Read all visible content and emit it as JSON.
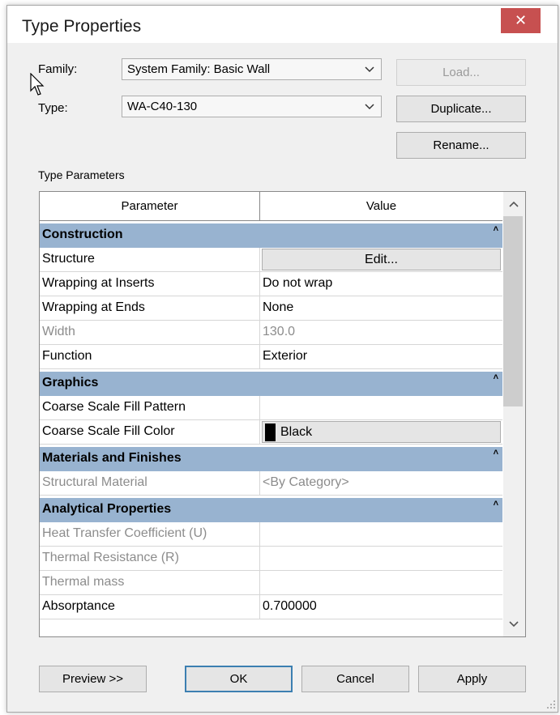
{
  "window": {
    "title": "Type Properties"
  },
  "family": {
    "label": "Family:",
    "value": "System Family: Basic Wall"
  },
  "type": {
    "label": "Type:",
    "value": "WA-C40-130"
  },
  "buttons": {
    "load": "Load...",
    "duplicate": "Duplicate...",
    "rename": "Rename...",
    "preview": "Preview >>",
    "ok": "OK",
    "cancel": "Cancel",
    "apply": "Apply"
  },
  "section_label": "Type Parameters",
  "grid": {
    "header_parameter": "Parameter",
    "header_value": "Value",
    "groups": {
      "construction": "Construction",
      "graphics": "Graphics",
      "materials": "Materials and Finishes",
      "analytical": "Analytical Properties"
    },
    "rows": {
      "structure": {
        "name": "Structure",
        "value": "Edit..."
      },
      "wrap_inserts": {
        "name": "Wrapping at Inserts",
        "value": "Do not wrap"
      },
      "wrap_ends": {
        "name": "Wrapping at Ends",
        "value": "None"
      },
      "width": {
        "name": "Width",
        "value": "130.0"
      },
      "function": {
        "name": "Function",
        "value": "Exterior"
      },
      "fill_pattern": {
        "name": "Coarse Scale Fill Pattern",
        "value": ""
      },
      "fill_color": {
        "name": "Coarse Scale Fill Color",
        "value": "Black"
      },
      "struct_material": {
        "name": "Structural Material",
        "value": "<By Category>"
      },
      "heat_coeff": {
        "name": "Heat Transfer Coefficient (U)",
        "value": ""
      },
      "thermal_res": {
        "name": "Thermal Resistance (R)",
        "value": ""
      },
      "thermal_mass": {
        "name": "Thermal mass",
        "value": ""
      },
      "absorptance": {
        "name": "Absorptance",
        "value": "0.700000"
      }
    }
  },
  "colors": {
    "group_header": "#98b3d0",
    "close_button": "#c75050",
    "fill_color_swatch": "#000000"
  }
}
